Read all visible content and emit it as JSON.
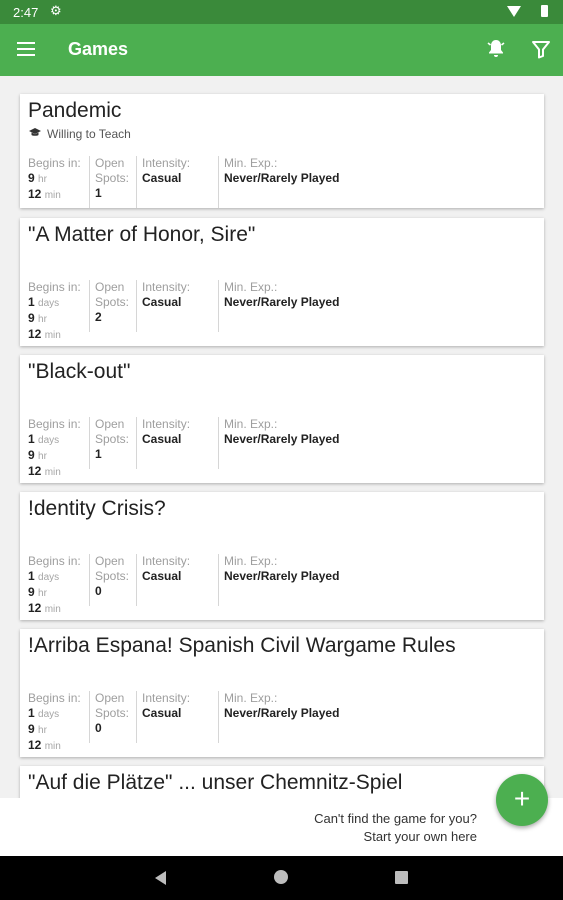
{
  "status_bar": {
    "time": "2:47",
    "gear_icon": "gear-icon"
  },
  "app_bar": {
    "title": "Games",
    "menu_icon": "menu-icon",
    "bell_icon": "notification-bell-icon",
    "filter_icon": "filter-icon"
  },
  "labels": {
    "begins_in": "Begins in:",
    "open": "Open",
    "spots": "Spots:",
    "intensity": "Intensity:",
    "min_exp": "Min. Exp.:",
    "days": "days",
    "hr": "hr",
    "min": "min"
  },
  "games": [
    {
      "title": "Pandemic",
      "note": "Willing to Teach",
      "days": null,
      "hours": "9",
      "minutes": "12",
      "open_spots": "1",
      "intensity": "Casual",
      "min_exp": "Never/Rarely Played"
    },
    {
      "title": "\"A Matter of Honor, Sire\"",
      "note": "",
      "days": "1",
      "hours": "9",
      "minutes": "12",
      "open_spots": "2",
      "intensity": "Casual",
      "min_exp": "Never/Rarely Played"
    },
    {
      "title": "\"Black-out\"",
      "note": "",
      "days": "1",
      "hours": "9",
      "minutes": "12",
      "open_spots": "1",
      "intensity": "Casual",
      "min_exp": "Never/Rarely Played"
    },
    {
      "title": "!dentity Crisis?",
      "note": "",
      "days": "1",
      "hours": "9",
      "minutes": "12",
      "open_spots": "0",
      "intensity": "Casual",
      "min_exp": "Never/Rarely Played"
    },
    {
      "title": "!Arriba Espana! Spanish Civil Wargame Rules",
      "note": "",
      "days": "1",
      "hours": "9",
      "minutes": "12",
      "open_spots": "0",
      "intensity": "Casual",
      "min_exp": "Never/Rarely Played"
    },
    {
      "title": "\"Auf die Plätze\" ... unser Chemnitz-Spiel",
      "note": "",
      "days": null,
      "hours": null,
      "minutes": null,
      "open_spots": null,
      "intensity": null,
      "min_exp": null
    }
  ],
  "footer": {
    "line1": "Can't find the game for you?",
    "line2": "Start your own here",
    "fab_label": "+"
  },
  "colors": {
    "primary": "#4caf50",
    "status_bar": "#3a8a3a"
  }
}
